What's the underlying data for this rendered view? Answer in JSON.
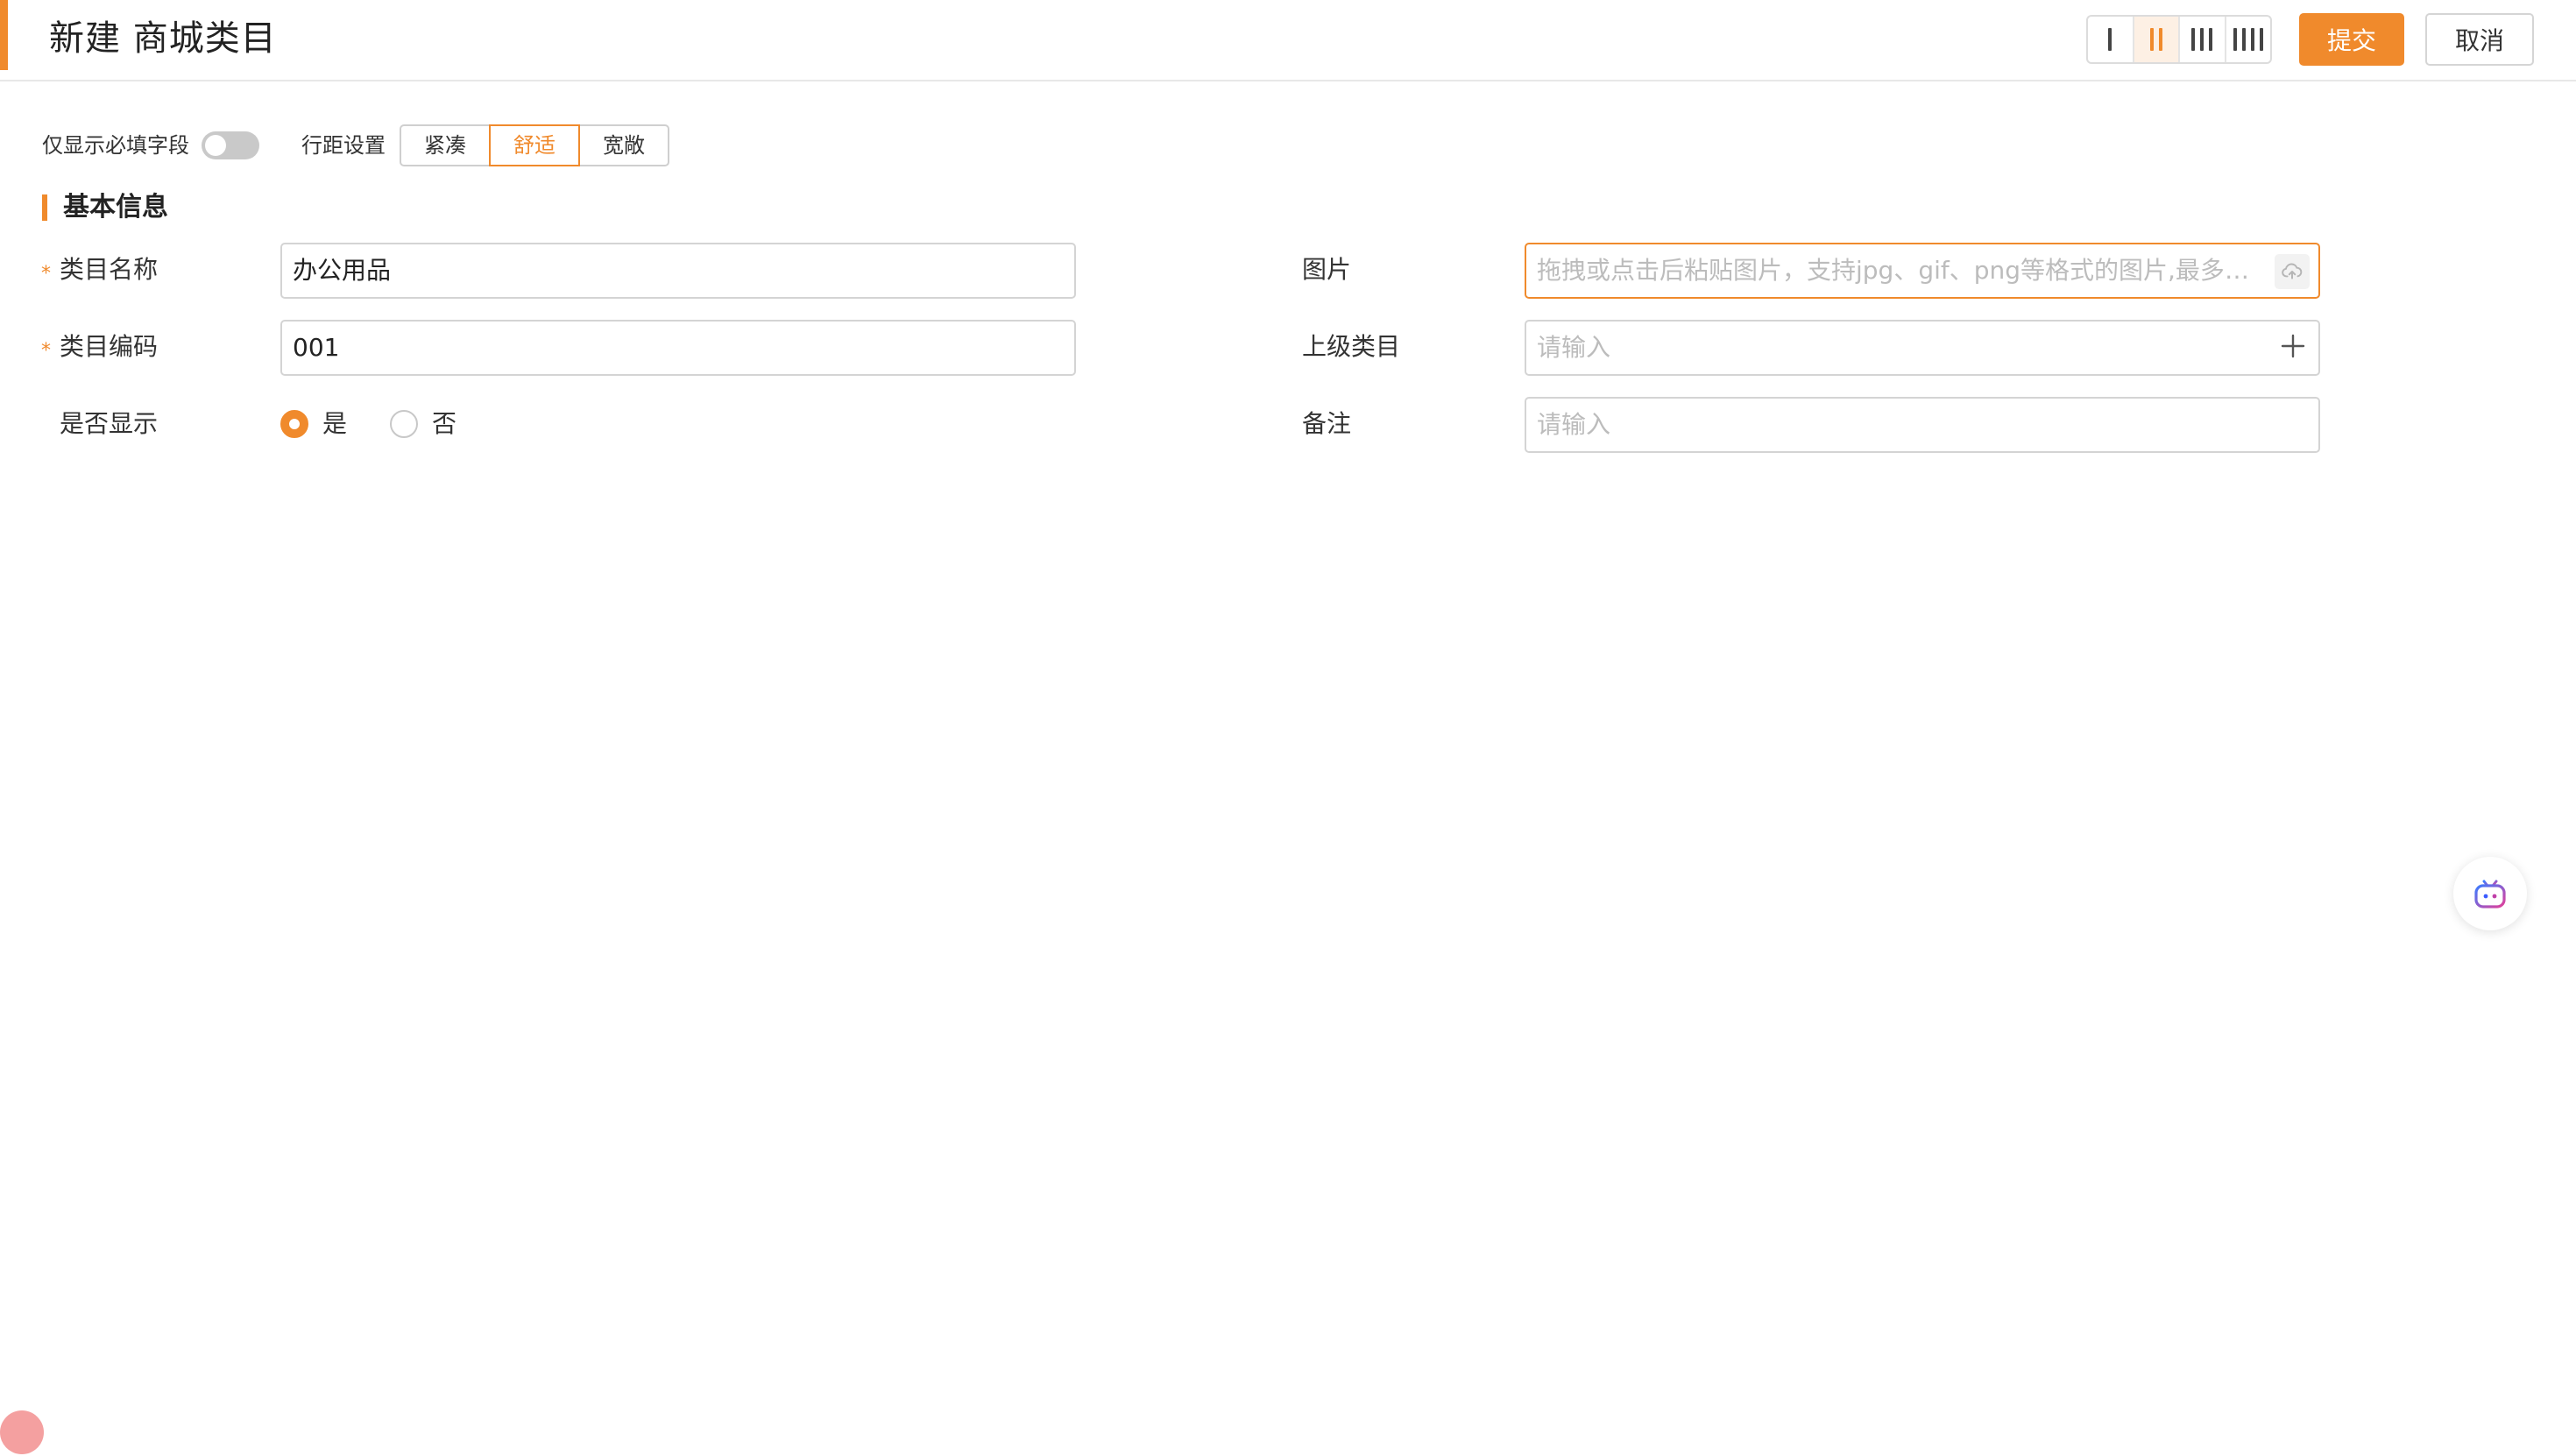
{
  "header": {
    "title": "新建 商城类目",
    "column_options": [
      "1",
      "2",
      "3",
      "4"
    ],
    "active_columns": "2",
    "submit_label": "提交",
    "cancel_label": "取消"
  },
  "toolbar": {
    "required_only_label": "仅显示必填字段",
    "required_only_on": false,
    "spacing_label": "行距设置",
    "spacing_options": [
      "紧凑",
      "舒适",
      "宽敞"
    ],
    "spacing_selected": "舒适"
  },
  "section": {
    "title": "基本信息"
  },
  "form": {
    "name": {
      "label": "类目名称",
      "required": true,
      "value": "办公用品"
    },
    "code": {
      "label": "类目编码",
      "required": true,
      "value": "001"
    },
    "visible": {
      "label": "是否显示",
      "options": [
        "是",
        "否"
      ],
      "selected": "是"
    },
    "image": {
      "label": "图片",
      "placeholder": "拖拽或点击后粘贴图片，支持jpg、gif、png等格式的图片,最多可..."
    },
    "parent": {
      "label": "上级类目",
      "placeholder": "请输入"
    },
    "remark": {
      "label": "备注",
      "placeholder": "请输入"
    }
  },
  "colors": {
    "accent": "#f08a2c",
    "border": "#d4d4d4",
    "placeholder": "#bcbcbc"
  },
  "icons": {
    "upload": "cloud-upload-icon",
    "plus": "plus-icon",
    "assistant": "robot-assistant-icon"
  }
}
